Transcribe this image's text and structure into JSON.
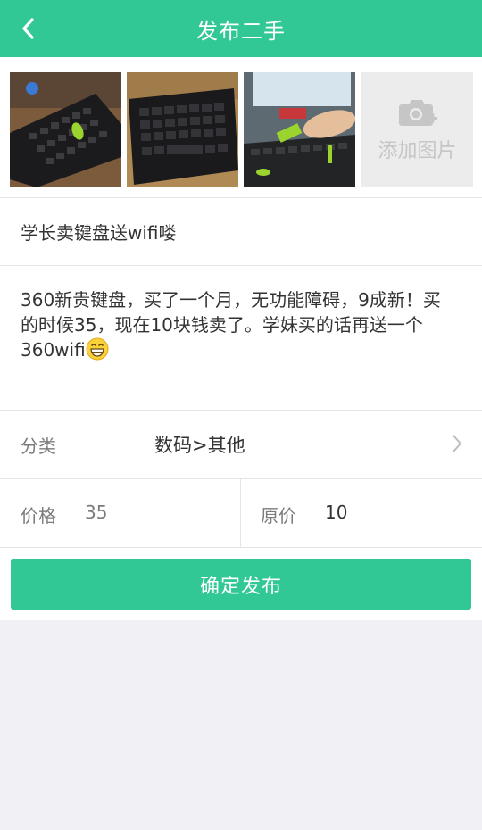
{
  "header": {
    "title": "发布二手",
    "back_icon": "chevron-left-icon"
  },
  "photos": {
    "items": [
      {
        "name": "keyboard-photo-1"
      },
      {
        "name": "keyboard-photo-2"
      },
      {
        "name": "keyboard-photo-3"
      }
    ],
    "add_label": "添加图片",
    "add_icon": "camera-plus-icon"
  },
  "listing": {
    "title": "学长卖键盘送wifi喽",
    "description": "360新贵键盘，买了一个月，无功能障碍，9成新！买的时候35，现在10块钱卖了。学妹买的话再送一个360wifi",
    "description_emoji": "grinning-face-icon"
  },
  "category": {
    "label": "分类",
    "value": "数码>其他"
  },
  "price": {
    "label": "价格",
    "value": "35"
  },
  "original_price": {
    "label": "原价",
    "value": "10"
  },
  "submit": {
    "label": "确定发布"
  },
  "colors": {
    "accent": "#32c896",
    "background": "#f1f1f5"
  }
}
